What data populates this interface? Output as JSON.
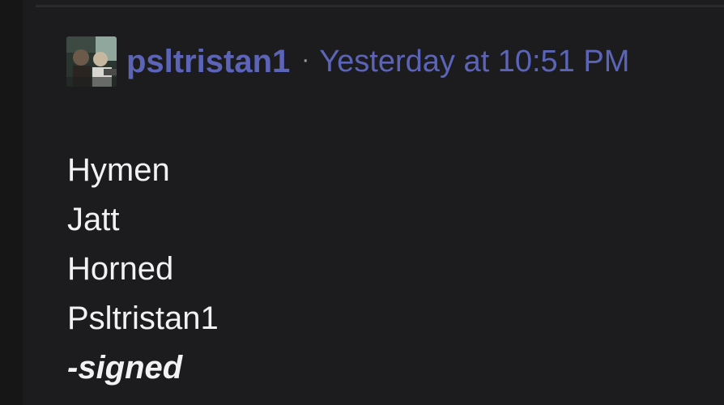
{
  "post": {
    "author": "psltristan1",
    "separator": "·",
    "timestamp": "Yesterday at 10:51 PM",
    "lines": [
      "Hymen",
      "Jatt",
      "Horned",
      "Psltristan1"
    ],
    "signature": "-signed"
  },
  "colors": {
    "background": "#1c1c1e",
    "accent": "#5c64b8",
    "text": "#f2f2f4"
  }
}
